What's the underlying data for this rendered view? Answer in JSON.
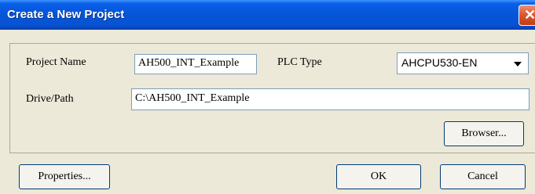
{
  "window": {
    "title": "Create a New Project",
    "close_glyph": "✕"
  },
  "form": {
    "project_name_label": "Project Name",
    "project_name_value": "AH500_INT_Example",
    "plc_type_label": "PLC Type",
    "plc_type_value": "AHCPU530-EN",
    "drive_path_label": "Drive/Path",
    "drive_path_value": "C:\\AH500_INT_Example"
  },
  "buttons": {
    "browser": "Browser...",
    "properties": "Properties...",
    "ok": "OK",
    "cancel": "Cancel"
  },
  "icons": {
    "close": "close-icon",
    "dropdown": "chevron-down-icon"
  },
  "colors": {
    "titlebar": "#0556d6",
    "close_button": "#dd5a35",
    "dialog_bg": "#ece9d8"
  }
}
